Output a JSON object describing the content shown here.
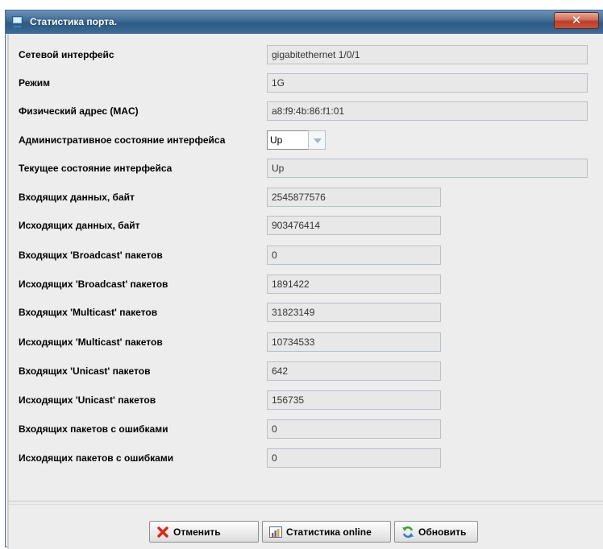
{
  "window": {
    "title": "Статистика порта.",
    "close_glyph": "✕"
  },
  "form": {
    "interface_label": "Сетевой интерфейс",
    "interface_value": "gigabitethernet 1/0/1",
    "mode_label": "Режим",
    "mode_value": "1G",
    "mac_label": "Физический адрес (MAC)",
    "mac_value": "a8:f9:4b:86:f1:01",
    "admin_label": "Административное состояние интерфейса",
    "admin_value": "Up",
    "oper_label": "Текущее состояние интерфейса",
    "oper_value": "Up",
    "in_bytes_label": "Входящих данных, байт",
    "in_bytes_value": "2545877576",
    "out_bytes_label": "Исходящих данных, байт",
    "out_bytes_value": "903476414",
    "in_bcast_label": "Входящих 'Broadcast' пакетов",
    "in_bcast_value": "0",
    "out_bcast_label": "Исходящих 'Broadcast' пакетов",
    "out_bcast_value": "1891422",
    "in_mcast_label": "Входящих 'Multicast' пакетов",
    "in_mcast_value": "31823149",
    "out_mcast_label": "Исходящих 'Multicast' пакетов",
    "out_mcast_value": "10734533",
    "in_ucast_label": "Входящих 'Unicast' пакетов",
    "in_ucast_value": "642",
    "out_ucast_label": "Исходящих 'Unicast' пакетов",
    "out_ucast_value": "156735",
    "in_err_label": "Входящих пакетов с ошибками",
    "in_err_value": "0",
    "out_err_label": "Исходящих пакетов с ошибками",
    "out_err_value": "0"
  },
  "buttons": {
    "cancel": "Отменить",
    "online": "Статистика online",
    "refresh": "Обновить"
  },
  "icons": {
    "window": "monitor-icon",
    "cancel": "red-x-icon",
    "online": "chart-icon",
    "refresh": "refresh-icon"
  },
  "colors": {
    "titlebar": "#3e6a92",
    "close": "#c7533e",
    "cancel_icon": "#d42a1a",
    "refresh_icon": "#3fa33a"
  }
}
